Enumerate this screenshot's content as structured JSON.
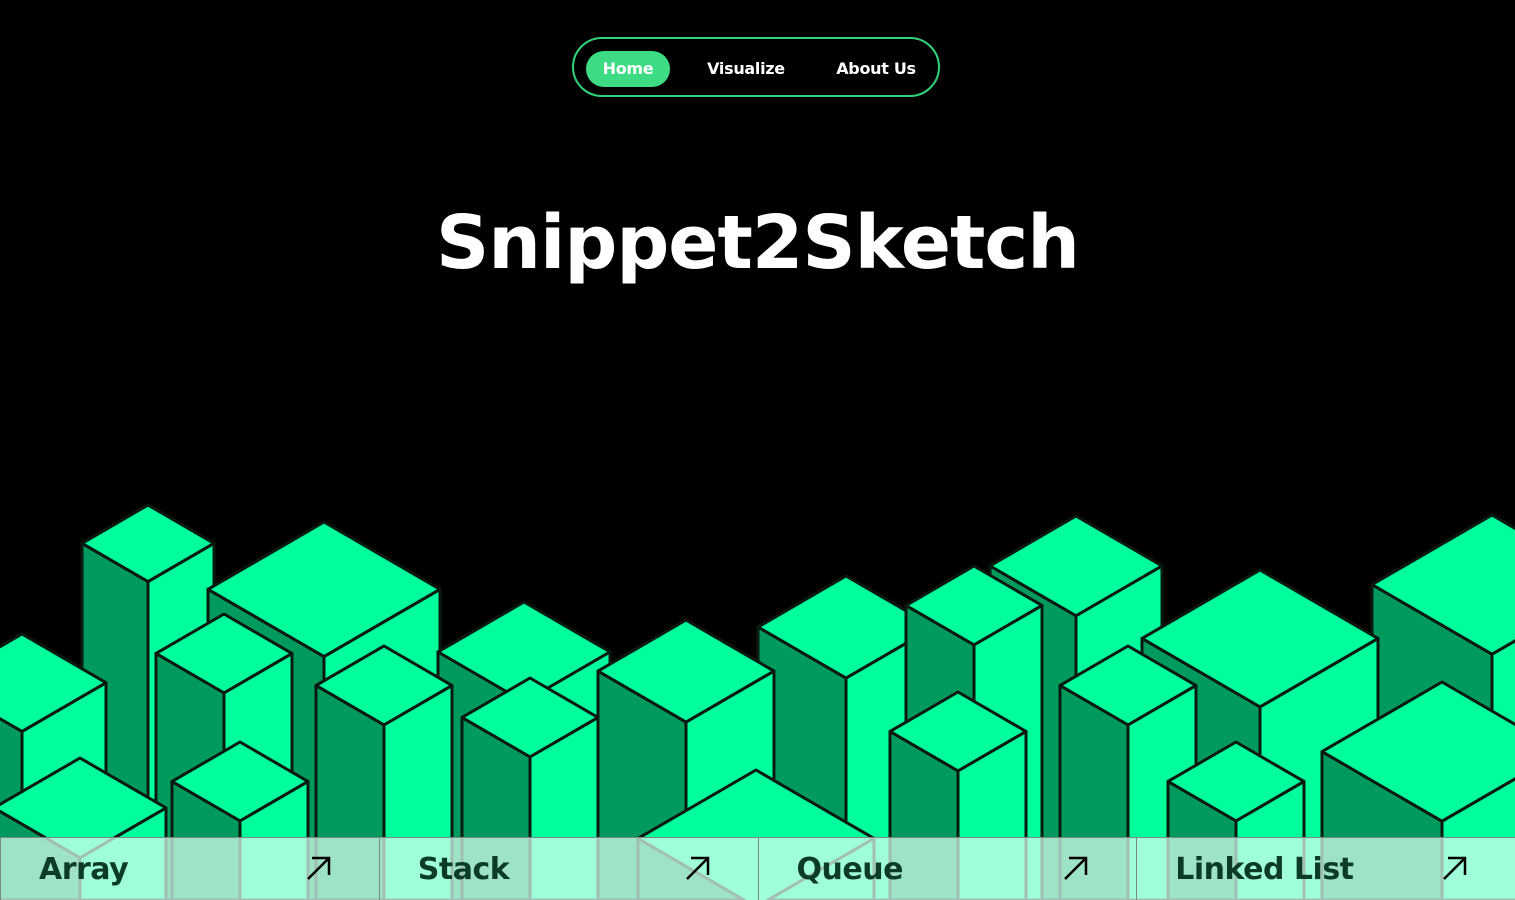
{
  "nav": {
    "items": [
      {
        "label": "Home",
        "active": true
      },
      {
        "label": "Visualize",
        "active": false
      },
      {
        "label": "About Us",
        "active": false
      }
    ]
  },
  "hero": {
    "title": "Snippet2Sketch"
  },
  "cards": [
    {
      "label": "Array",
      "icon": "arrow-up-right-icon"
    },
    {
      "label": "Stack",
      "icon": "arrow-up-right-icon"
    },
    {
      "label": "Queue",
      "icon": "arrow-up-right-icon"
    },
    {
      "label": "Linked List",
      "icon": "arrow-up-right-icon"
    }
  ],
  "colors": {
    "background": "#000000",
    "accent": "#3ddc84",
    "cube_top": "#00ff9c",
    "cube_right": "#00ff9c",
    "cube_left": "#009a5e",
    "card_text": "#0c3b26"
  }
}
